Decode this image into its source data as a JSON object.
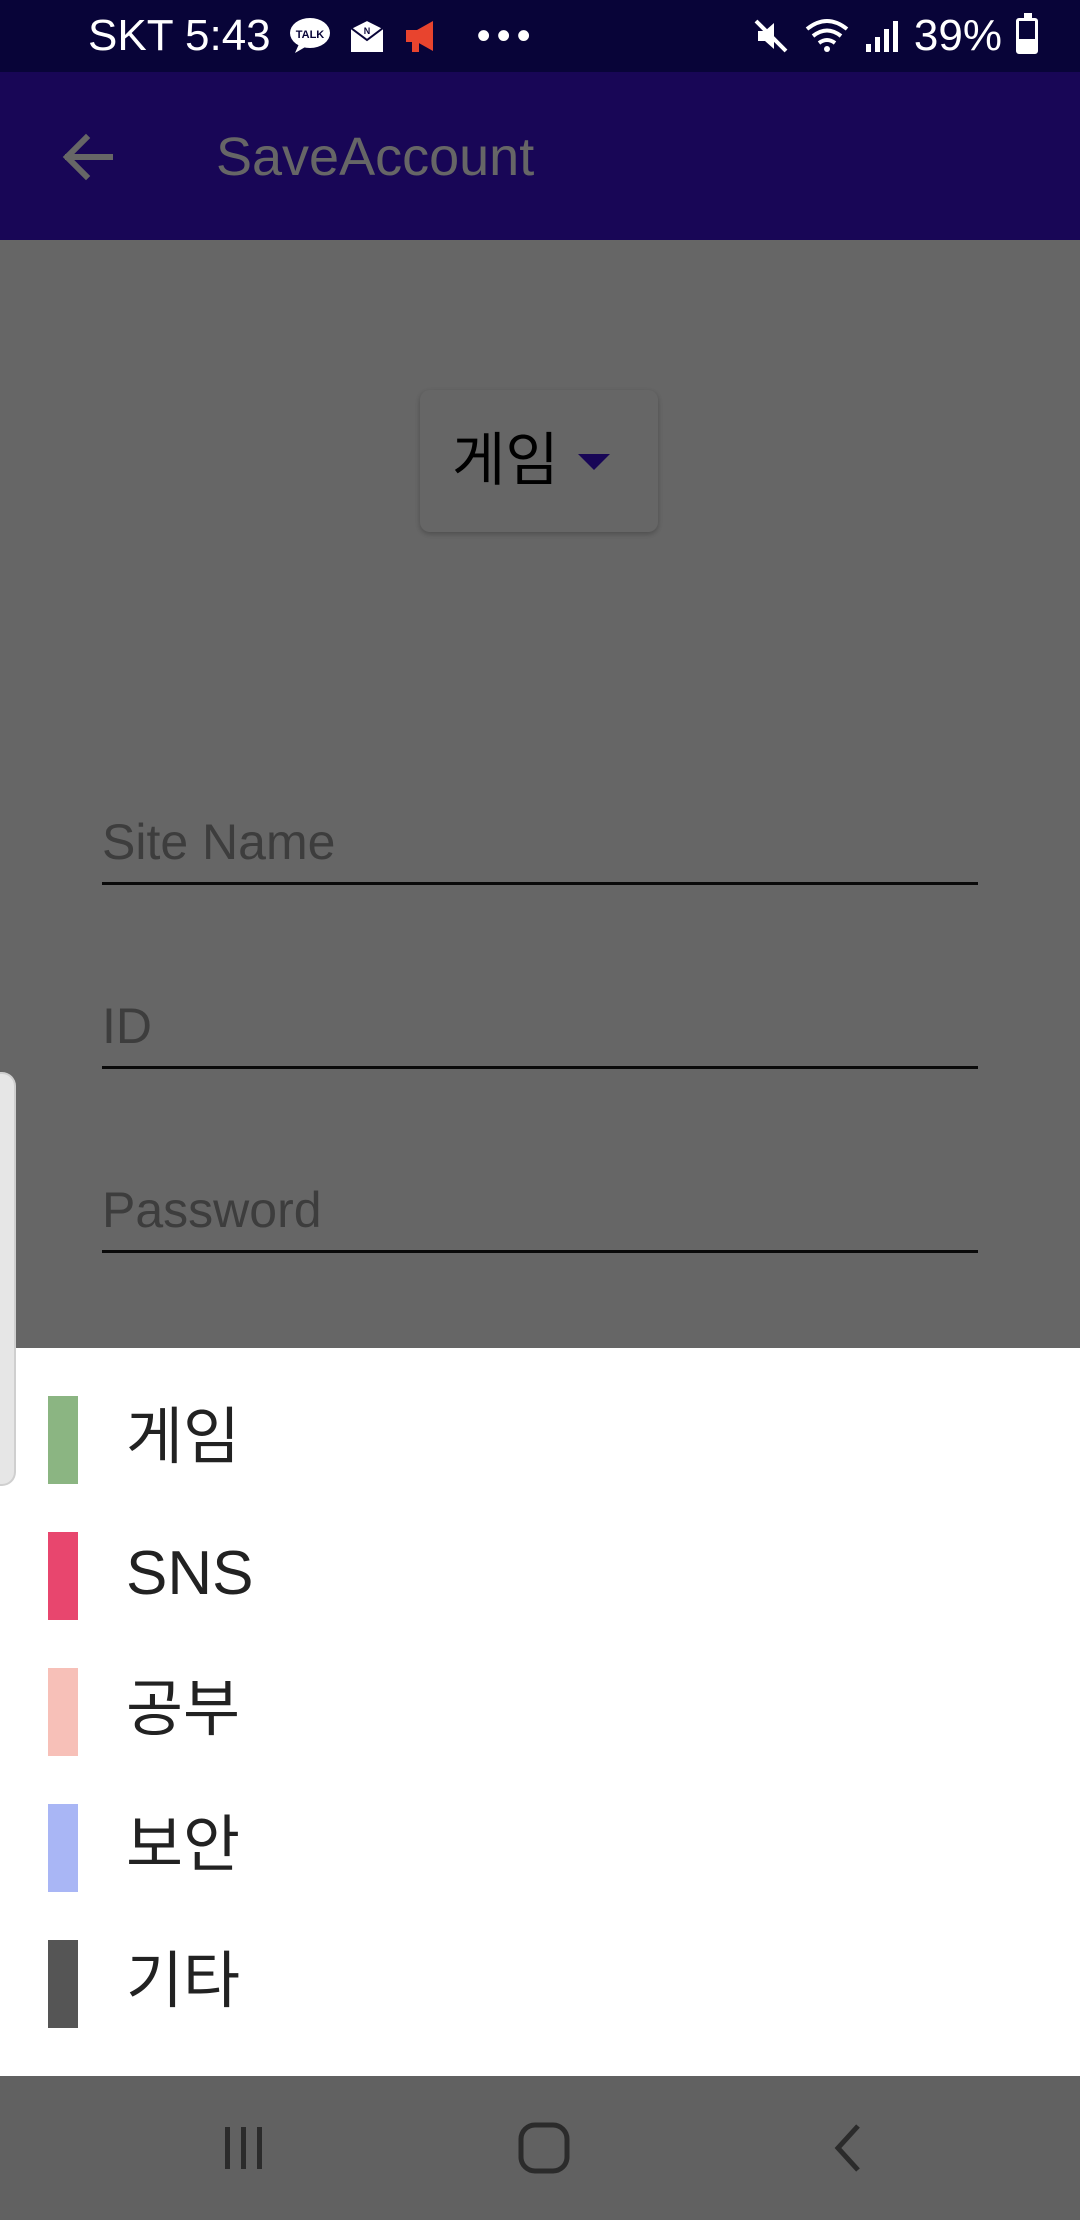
{
  "status_bar": {
    "carrier_time": "SKT 5:43",
    "battery": "39%",
    "icons": [
      "talk-icon",
      "mail-icon",
      "megaphone-icon",
      "more-dots-icon",
      "mute-icon",
      "wifi-icon",
      "signal-icon",
      "battery-icon"
    ],
    "battery_level": 0.39
  },
  "app_bar": {
    "title": "SaveAccount",
    "back_icon": "arrow-left-icon",
    "color": "#3d10d6"
  },
  "form": {
    "category_selected": "게임",
    "site_name_placeholder": "Site Name",
    "id_placeholder": "ID",
    "password_placeholder": "Password"
  },
  "dropdown": {
    "options": [
      {
        "label": "게임",
        "color": "#8bb582"
      },
      {
        "label": "SNS",
        "color": "#e8466e"
      },
      {
        "label": "공부",
        "color": "#f7c0b8"
      },
      {
        "label": "보안",
        "color": "#a9b6f5"
      },
      {
        "label": "기타",
        "color": "#555555"
      }
    ]
  },
  "nav_bar": {
    "icons": [
      "recents-icon",
      "home-icon",
      "back-icon"
    ]
  }
}
